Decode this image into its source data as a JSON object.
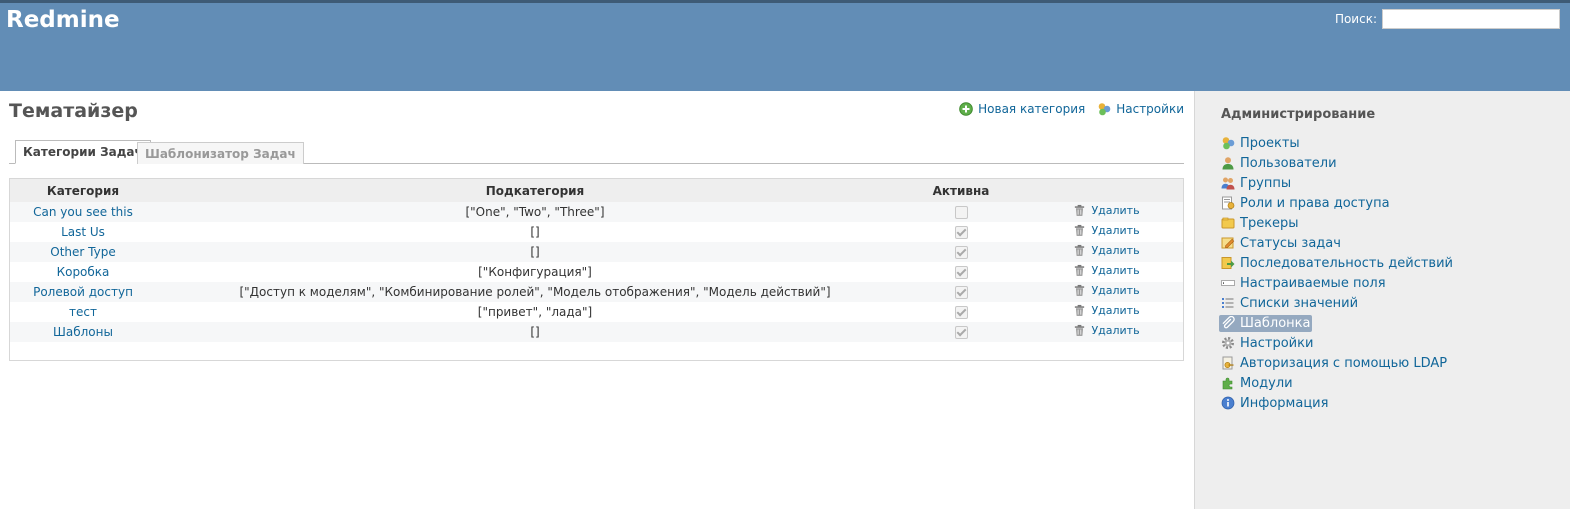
{
  "header": {
    "app_title": "Redmine",
    "search_label": "Поиск:",
    "search_value": ""
  },
  "page": {
    "title": "Тематайзер",
    "actions": {
      "new_category": "Новая категория",
      "settings": "Настройки"
    },
    "tabs": [
      {
        "label": "Категории Задач",
        "selected": true
      },
      {
        "label": "Шаблонизатор Задач",
        "selected": false
      }
    ]
  },
  "table": {
    "columns": {
      "category": "Категория",
      "subcategory": "Подкатегория",
      "active": "Активна"
    },
    "rows": [
      {
        "category": "Can you see this",
        "subcategory": "[\"One\", \"Two\", \"Three\"]",
        "active": false,
        "action": "Удалить"
      },
      {
        "category": "Last Us",
        "subcategory": "[]",
        "active": true,
        "action": "Удалить"
      },
      {
        "category": "Other Type",
        "subcategory": "[]",
        "active": true,
        "action": "Удалить"
      },
      {
        "category": "Коробка",
        "subcategory": "[\"Конфигурация\"]",
        "active": true,
        "action": "Удалить"
      },
      {
        "category": "Ролевой доступ",
        "subcategory": "[\"Доступ к моделям\", \"Комбинирование ролей\", \"Модель отображения\", \"Модель действий\"]",
        "active": true,
        "action": "Удалить"
      },
      {
        "category": "тест",
        "subcategory": "[\"привет\", \"лада\"]",
        "active": true,
        "action": "Удалить"
      },
      {
        "category": "Шаблоны",
        "subcategory": "[]",
        "active": true,
        "action": "Удалить"
      }
    ]
  },
  "sidebar": {
    "title": "Администрирование",
    "items": [
      {
        "label": "Проекты",
        "icon": "projects-icon",
        "selected": false
      },
      {
        "label": "Пользователи",
        "icon": "user-icon",
        "selected": false
      },
      {
        "label": "Группы",
        "icon": "group-icon",
        "selected": false
      },
      {
        "label": "Роли и права доступа",
        "icon": "roles-icon",
        "selected": false
      },
      {
        "label": "Трекеры",
        "icon": "trackers-icon",
        "selected": false
      },
      {
        "label": "Статусы задач",
        "icon": "issue-statuses-icon",
        "selected": false
      },
      {
        "label": "Последовательность действий",
        "icon": "workflow-icon",
        "selected": false
      },
      {
        "label": "Настраиваемые поля",
        "icon": "custom-fields-icon",
        "selected": false
      },
      {
        "label": "Списки значений",
        "icon": "enumerations-icon",
        "selected": false
      },
      {
        "label": "Шаблонка",
        "icon": "paperclip-icon",
        "selected": true
      },
      {
        "label": "Настройки",
        "icon": "gear-icon",
        "selected": false
      },
      {
        "label": "Авторизация с помощью LDAP",
        "icon": "ldap-icon",
        "selected": false
      },
      {
        "label": "Модули",
        "icon": "plugins-icon",
        "selected": false
      },
      {
        "label": "Информация",
        "icon": "info-icon",
        "selected": false
      }
    ]
  },
  "colors": {
    "header_bg": "#628DB6",
    "top_strip": "#3E5B76",
    "link": "#169",
    "sidebar_bg": "#EEEEEE",
    "selected_bg": "#95A9C0"
  }
}
